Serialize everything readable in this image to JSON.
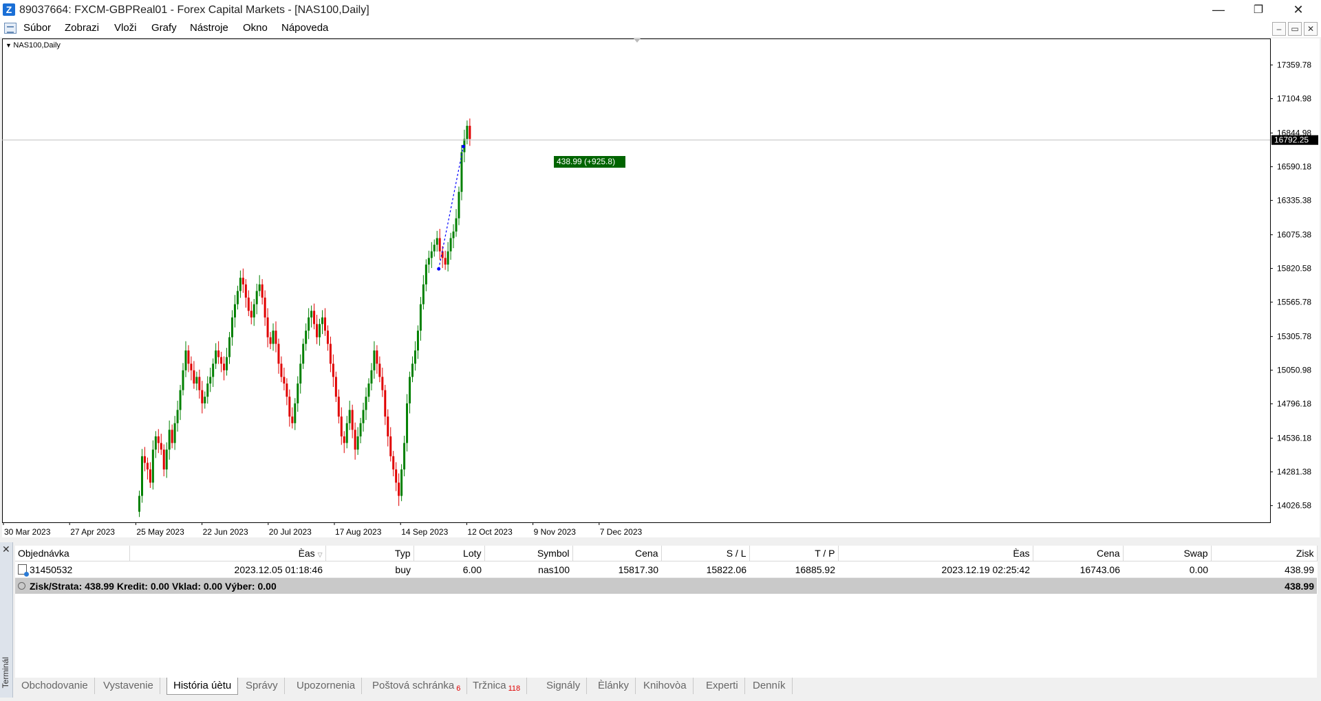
{
  "window": {
    "title": "89037664: FXCM-GBPReal01 - Forex Capital Markets - [NAS100,Daily]",
    "minimize": "—",
    "restore": "❐",
    "close": "✕"
  },
  "menu": {
    "items": [
      "Súbor",
      "Zobrazi",
      "Vloži",
      "Grafy",
      "Nástroje",
      "Okno",
      "Nápoveda"
    ]
  },
  "mdi": {
    "minimize": "–",
    "restore": "▭",
    "close": "✕"
  },
  "chart": {
    "label": "NAS100,Daily",
    "current_price": "16792.25",
    "trade_label": "438.99 (+925.8)",
    "colors": {
      "up": "#008000",
      "down": "#e00000",
      "price_line": "#c0c0c0",
      "label_bg": "#006400"
    },
    "chart_data": {
      "type": "candlestick",
      "symbol": "NAS100",
      "timeframe": "Daily",
      "ylim": [
        13900,
        17550
      ],
      "y_ticks": [
        "17359.78",
        "17104.98",
        "16844.98",
        "16590.18",
        "16335.38",
        "16075.38",
        "15820.58",
        "15565.78",
        "15305.78",
        "15050.98",
        "14796.18",
        "14536.18",
        "14281.38",
        "14026.58"
      ],
      "x_ticks": [
        "30 Mar 2023",
        "27 Apr 2023",
        "25 May 2023",
        "22 Jun 2023",
        "20 Jul 2023",
        "17 Aug 2023",
        "14 Sep 2023",
        "12 Oct 2023",
        "9 Nov 2023",
        "7 Dec 2023"
      ],
      "closes": [
        14100,
        14400,
        14350,
        14300,
        14200,
        14450,
        14550,
        14500,
        14450,
        14300,
        14450,
        14600,
        14500,
        14650,
        14750,
        14900,
        15050,
        15200,
        15100,
        15050,
        14950,
        15000,
        14900,
        14800,
        14850,
        14950,
        15000,
        15100,
        15200,
        15150,
        15100,
        15050,
        15150,
        15300,
        15450,
        15550,
        15650,
        15750,
        15700,
        15600,
        15500,
        15450,
        15550,
        15650,
        15700,
        15600,
        15450,
        15300,
        15250,
        15350,
        15250,
        15100,
        15000,
        14950,
        14850,
        14700,
        14650,
        14800,
        14950,
        15100,
        15250,
        15350,
        15450,
        15500,
        15400,
        15300,
        15400,
        15450,
        15350,
        15250,
        15100,
        15000,
        14850,
        14700,
        14550,
        14500,
        14650,
        14750,
        14600,
        14450,
        14550,
        14650,
        14750,
        14850,
        14950,
        15050,
        15200,
        15100,
        15000,
        14900,
        14700,
        14550,
        14400,
        14300,
        14200,
        14100,
        14300,
        14500,
        14800,
        15000,
        15100,
        15200,
        15350,
        15550,
        15700,
        15850,
        15900,
        15950,
        16000,
        16050,
        15950,
        15900,
        15850,
        15950,
        16050,
        16100,
        16200,
        16400,
        16700,
        16800,
        16900,
        16800
      ]
    },
    "trade": {
      "open_price": 15817.3,
      "close_price": 16743.06
    }
  },
  "terminal": {
    "side_label": "Terminál",
    "close": "✕",
    "columns": [
      "Objednávka",
      "Èas",
      "Typ",
      "Loty",
      "Symbol",
      "Cena",
      "S / L",
      "T / P",
      "Èas",
      "Cena",
      "Swap",
      "Zisk"
    ],
    "rows": [
      {
        "order": "31450532",
        "open_time": "2023.12.05 01:18:46",
        "type": "buy",
        "lots": "6.00",
        "symbol": "nas100",
        "open_price": "15817.30",
        "sl": "15822.06",
        "tp": "16885.92",
        "close_time": "2023.12.19 02:25:42",
        "close_price": "16743.06",
        "swap": "0.00",
        "profit": "438.99"
      }
    ],
    "summary": {
      "text": "Zisk/Strata: 438.99  Kredit: 0.00  Vklad: 0.00  Výber: 0.00",
      "total": "438.99"
    },
    "tabs": [
      {
        "label": "Obchodovanie"
      },
      {
        "label": "Vystavenie"
      },
      {
        "label": "História úètu",
        "active": true
      },
      {
        "label": "Správy"
      },
      {
        "label": "Upozornenia"
      },
      {
        "label": "Poštová schránka",
        "badge": "6"
      },
      {
        "label": "Tržnica",
        "badge": "118"
      },
      {
        "label": "Signály"
      },
      {
        "label": "Èlánky"
      },
      {
        "label": "Knihovòa"
      },
      {
        "label": "Experti"
      },
      {
        "label": "Denník"
      }
    ]
  }
}
